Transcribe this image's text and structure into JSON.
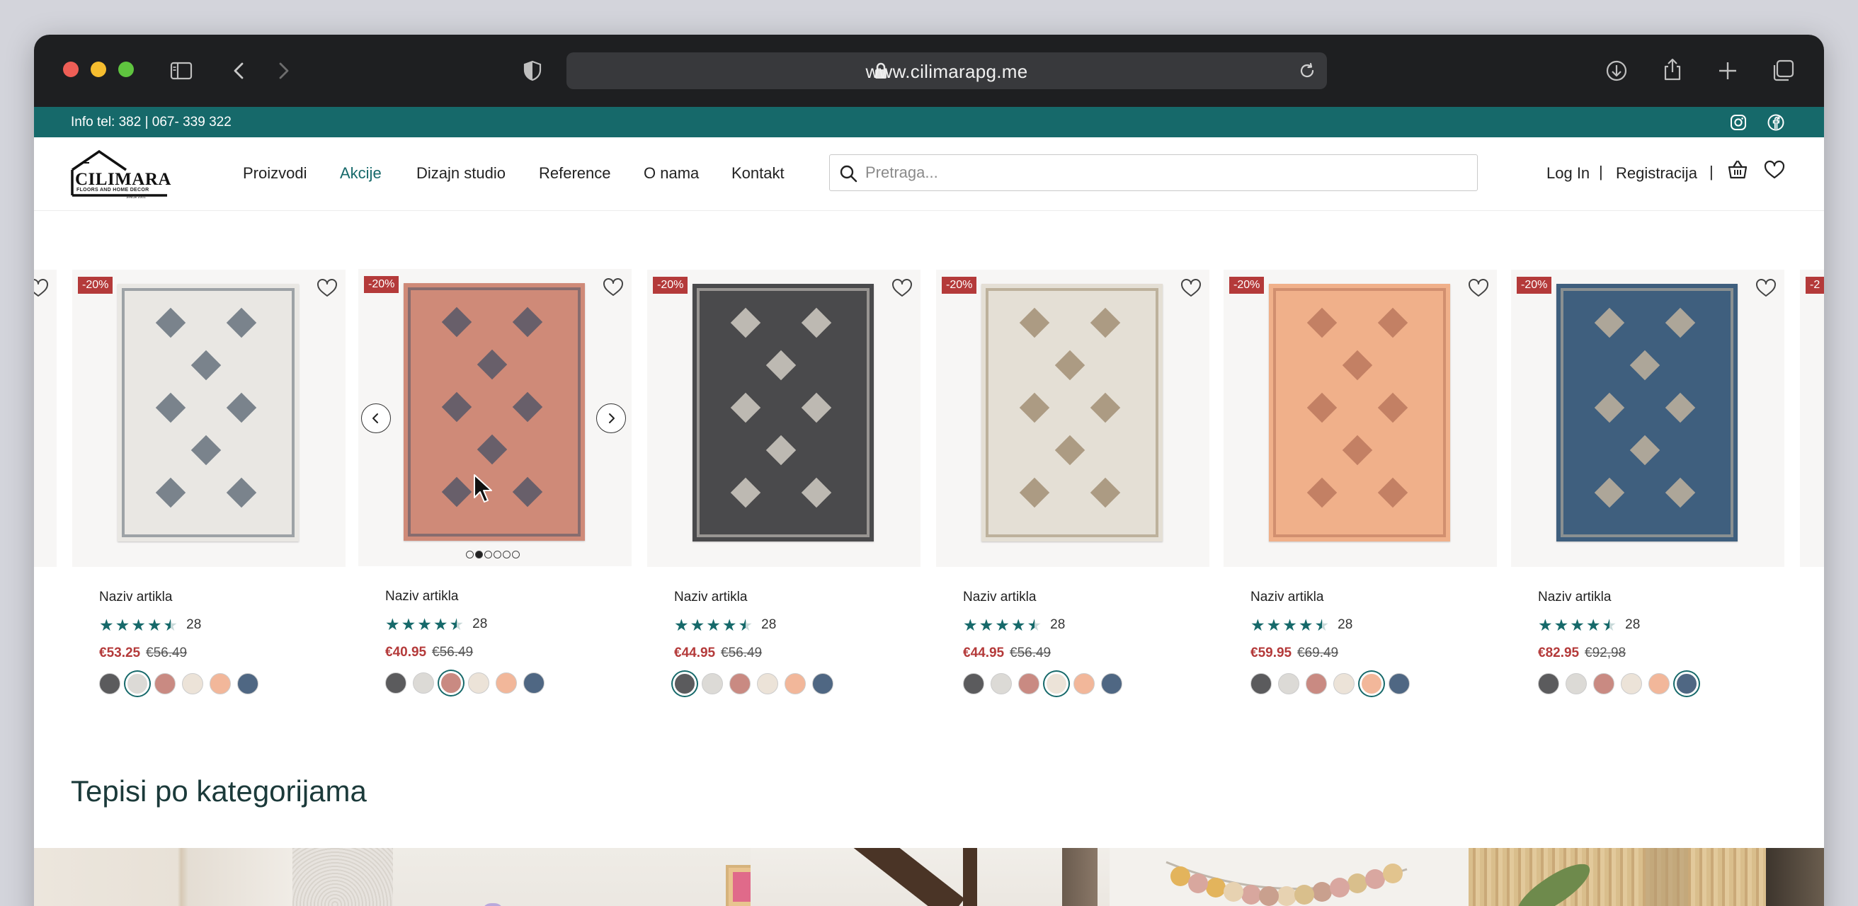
{
  "browser": {
    "url": "www.cilimarapg.me",
    "controls": [
      "sidebar-icon",
      "back-icon",
      "forward-icon",
      "shield-icon",
      "download-icon",
      "share-icon",
      "new-tab-icon",
      "tabs-icon"
    ]
  },
  "topbar": {
    "info": "Info tel: 382 | 067- 339 322",
    "social": [
      "instagram-icon",
      "facebook-icon"
    ]
  },
  "logo": {
    "name": "CILIMARA",
    "tagline": "FLOORS AND HOME DECOR",
    "since": "SINCE 2001"
  },
  "nav": {
    "items": [
      {
        "label": "Proizvodi",
        "active": false
      },
      {
        "label": "Akcije",
        "active": true
      },
      {
        "label": "Dizajn studio",
        "active": false
      },
      {
        "label": "Reference",
        "active": false
      },
      {
        "label": "O nama",
        "active": false
      },
      {
        "label": "Kontakt",
        "active": false
      }
    ]
  },
  "search": {
    "placeholder": "Pretraga..."
  },
  "account": {
    "login": "Log In",
    "register": "Registracija",
    "separator": "|"
  },
  "colors": {
    "accent": "#16696a",
    "sale": "#b43a3a"
  },
  "carousel": {
    "products": [
      {
        "badge": "-20%",
        "name": "Naziv artikla",
        "rating": 4.5,
        "reviews": "28",
        "price": "€53.25",
        "old_price": "€56.49",
        "rug_color": "#e9e7e3",
        "rug_accent": "#5e6a75",
        "selected_swatch": 1
      },
      {
        "badge": "-20%",
        "name": "Naziv artikla",
        "rating": 4.5,
        "reviews": "28",
        "price": "€40.95",
        "old_price": "€56.49",
        "rug_color": "#cf8a78",
        "rug_accent": "#4d5466",
        "selected_swatch": 2
      },
      {
        "badge": "-20%",
        "name": "Naziv artikla",
        "rating": 4.5,
        "reviews": "28",
        "price": "€44.95",
        "old_price": "€56.49",
        "rug_color": "#4a4a4c",
        "rug_accent": "#d9d4cc",
        "selected_swatch": 0
      },
      {
        "badge": "-20%",
        "name": "Naziv artikla",
        "rating": 4.5,
        "reviews": "28",
        "price": "€44.95",
        "old_price": "€56.49",
        "rug_color": "#e4dfd5",
        "rug_accent": "#9d8a6e",
        "selected_swatch": 3
      },
      {
        "badge": "-20%",
        "name": "Naziv artikla",
        "rating": 4.5,
        "reviews": "28",
        "price": "€59.95",
        "old_price": "€69.49",
        "rug_color": "#f0b08a",
        "rug_accent": "#b8745a",
        "selected_swatch": 4
      },
      {
        "badge": "-20%",
        "name": "Naziv artikla",
        "rating": 4.5,
        "reviews": "28",
        "price": "€82.95",
        "old_price": "€92,98",
        "rug_color": "#3f5f7e",
        "rug_accent": "#c9b8a0",
        "selected_swatch": 5
      }
    ],
    "swatch_colors": [
      "#5b5b5d",
      "#dcdad6",
      "#c98a82",
      "#ece3d8",
      "#f2b79a",
      "#4f6783"
    ],
    "active_card": 1,
    "page_dots": 6,
    "active_dot": 1,
    "partial_badge": "-2"
  },
  "categories": {
    "title": "Tepisi po kategorijama"
  }
}
